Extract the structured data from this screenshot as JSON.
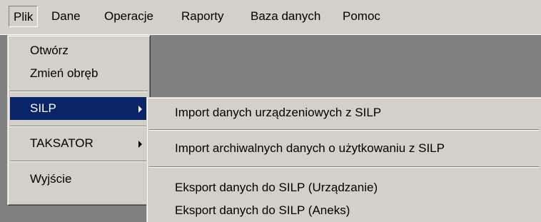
{
  "menubar": {
    "items": [
      {
        "label": "Plik"
      },
      {
        "label": "Dane"
      },
      {
        "label": "Operacje"
      },
      {
        "label": "Raporty"
      },
      {
        "label": "Baza danych"
      },
      {
        "label": "Pomoc"
      }
    ]
  },
  "file_menu": {
    "items": [
      {
        "label": "Otwórz"
      },
      {
        "label": "Zmień obręb"
      },
      {
        "label": "SILP"
      },
      {
        "label": "TAKSATOR"
      },
      {
        "label": "Wyjście"
      }
    ]
  },
  "silp_submenu": {
    "items": [
      {
        "label": "Import danych urządzeniowych z SILP"
      },
      {
        "label": "Import archiwalnych danych o użytkowaniu z SILP"
      },
      {
        "label": "Eksport danych do SILP (Urządzanie)"
      },
      {
        "label": "Eksport danych do SILP (Aneks)"
      }
    ]
  },
  "colors": {
    "menu_bg": "#d4d0c8",
    "highlight": "#0a246a",
    "desktop": "#808080"
  }
}
